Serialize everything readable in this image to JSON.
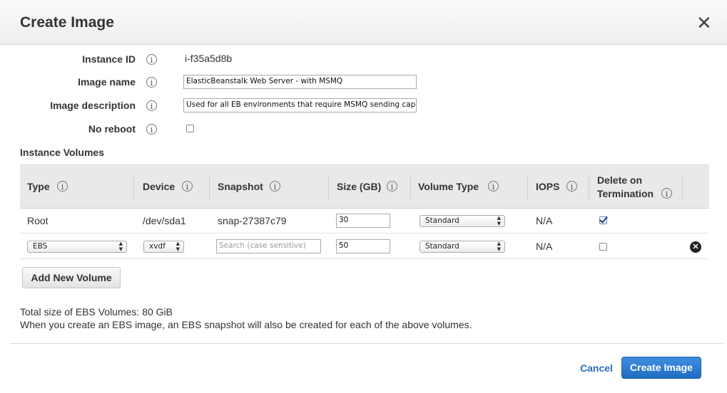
{
  "dialog": {
    "title": "Create Image",
    "close_glyph": "✕"
  },
  "form": {
    "instance_id": {
      "label": "Instance ID",
      "value": "i-f35a5d8b"
    },
    "image_name": {
      "label": "Image name",
      "value": "ElasticBeanstalk Web Server - with MSMQ"
    },
    "image_description": {
      "label": "Image description",
      "value": "Used for all EB environments that require MSMQ sending cap"
    },
    "no_reboot": {
      "label": "No reboot",
      "checked": false
    },
    "info_glyph": "i"
  },
  "volumes": {
    "section_title": "Instance Volumes",
    "headers": {
      "type": "Type",
      "device": "Device",
      "snapshot": "Snapshot",
      "size": "Size (GB)",
      "volume_type": "Volume Type",
      "iops": "IOPS",
      "delete_line1": "Delete on",
      "delete_line2": "Termination"
    },
    "rows": [
      {
        "type": "Root",
        "device": "/dev/sda1",
        "snapshot": "snap-27387c79",
        "size": "30",
        "volume_type": "Standard",
        "iops": "N/A",
        "delete_on_termination": true
      },
      {
        "type": "EBS",
        "device": "xvdf",
        "snapshot_placeholder": "Search (case sensitive)",
        "size": "50",
        "volume_type": "Standard",
        "iops": "N/A",
        "delete_on_termination": false,
        "remove_glyph": "✕"
      }
    ],
    "add_button": "Add New Volume",
    "total_size": "Total size of EBS Volumes: 80 GiB",
    "note": "When you create an EBS image, an EBS snapshot will also be created for each of the above volumes."
  },
  "footer": {
    "cancel_label": "Cancel",
    "create_label": "Create Image"
  },
  "colors": {
    "primary_button": "#1f6dc4",
    "link": "#2a6ebb",
    "table_header_bg": "#e9e9e9"
  }
}
